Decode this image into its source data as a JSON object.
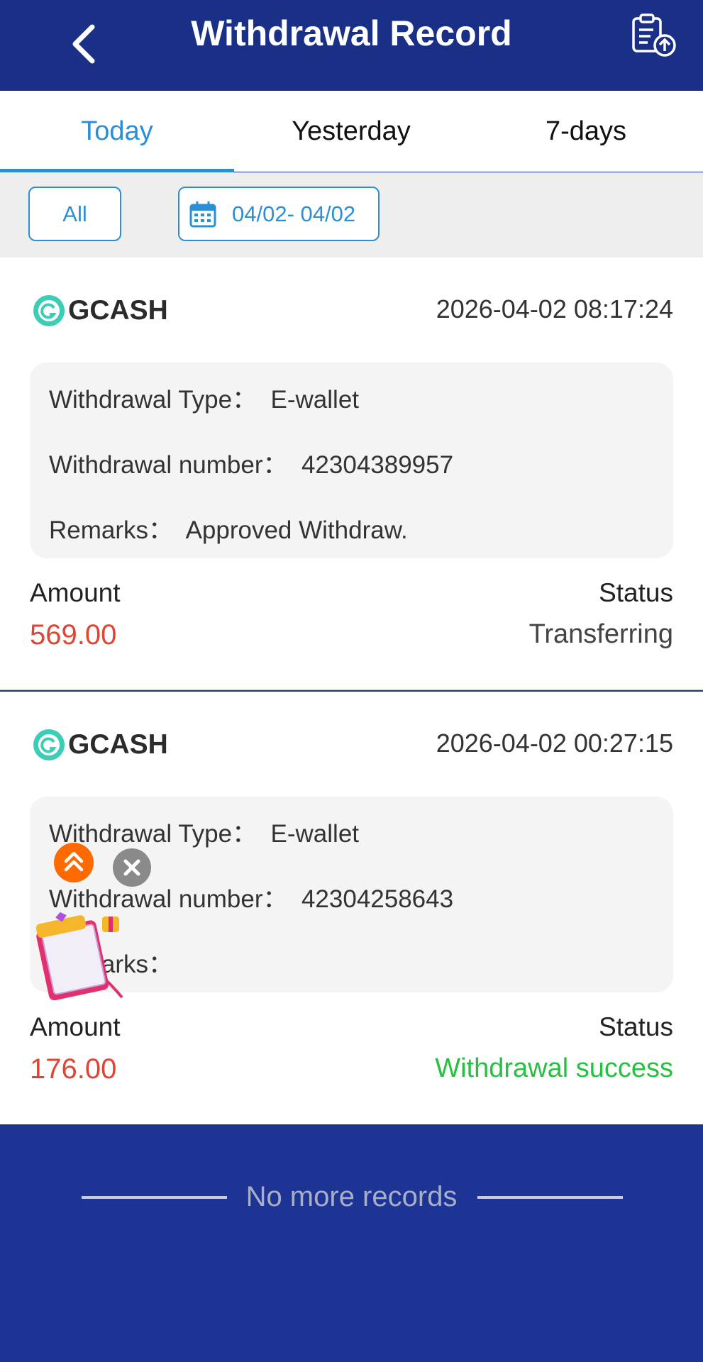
{
  "header": {
    "title": "Withdrawal Record",
    "back_icon": "chevron-left-icon",
    "export_icon": "clipboard-upload-icon",
    "background": "#1a2f86"
  },
  "tabs": [
    {
      "label": "Today",
      "active": true
    },
    {
      "label": "Yesterday",
      "active": false
    },
    {
      "label": "7-days",
      "active": false
    }
  ],
  "filters": {
    "type_label": "All",
    "date_range": "04/02- 04/02",
    "calendar_icon": "calendar-icon"
  },
  "records": [
    {
      "method": "GCASH",
      "time": "2026-04-02 08:17:24",
      "type_label": "Withdrawal Type：",
      "type_value": "E-wallet",
      "number_label": "Withdrawal number：",
      "number_value": "42304389957",
      "remarks_label": "Remarks：",
      "remarks_value": "Approved Withdraw.",
      "amount_label": "Amount",
      "amount": "569.00",
      "status_label": "Status",
      "status": "Transferring"
    },
    {
      "method": "GCASH",
      "time": "2026-04-02 00:27:15",
      "type_label": "Withdrawal Type：",
      "type_value": "E-wallet",
      "number_label": "Withdrawal number：",
      "number_value": "42304258643",
      "remarks_label": "Remarks：",
      "remarks_value": "",
      "amount_label": "Amount",
      "amount": "176.00",
      "status_label": "Status",
      "status": "Withdrawal success"
    }
  ],
  "footer": {
    "text": "No more records"
  },
  "colors": {
    "accent": "#2a8fd6",
    "amount": "#e04433",
    "success": "#27c041",
    "page_bg": "#1e3494"
  },
  "overlay": {
    "up_icon": "double-chevron-up-icon",
    "close_icon": "close-icon",
    "gift_icon": "gift-book-icon"
  }
}
